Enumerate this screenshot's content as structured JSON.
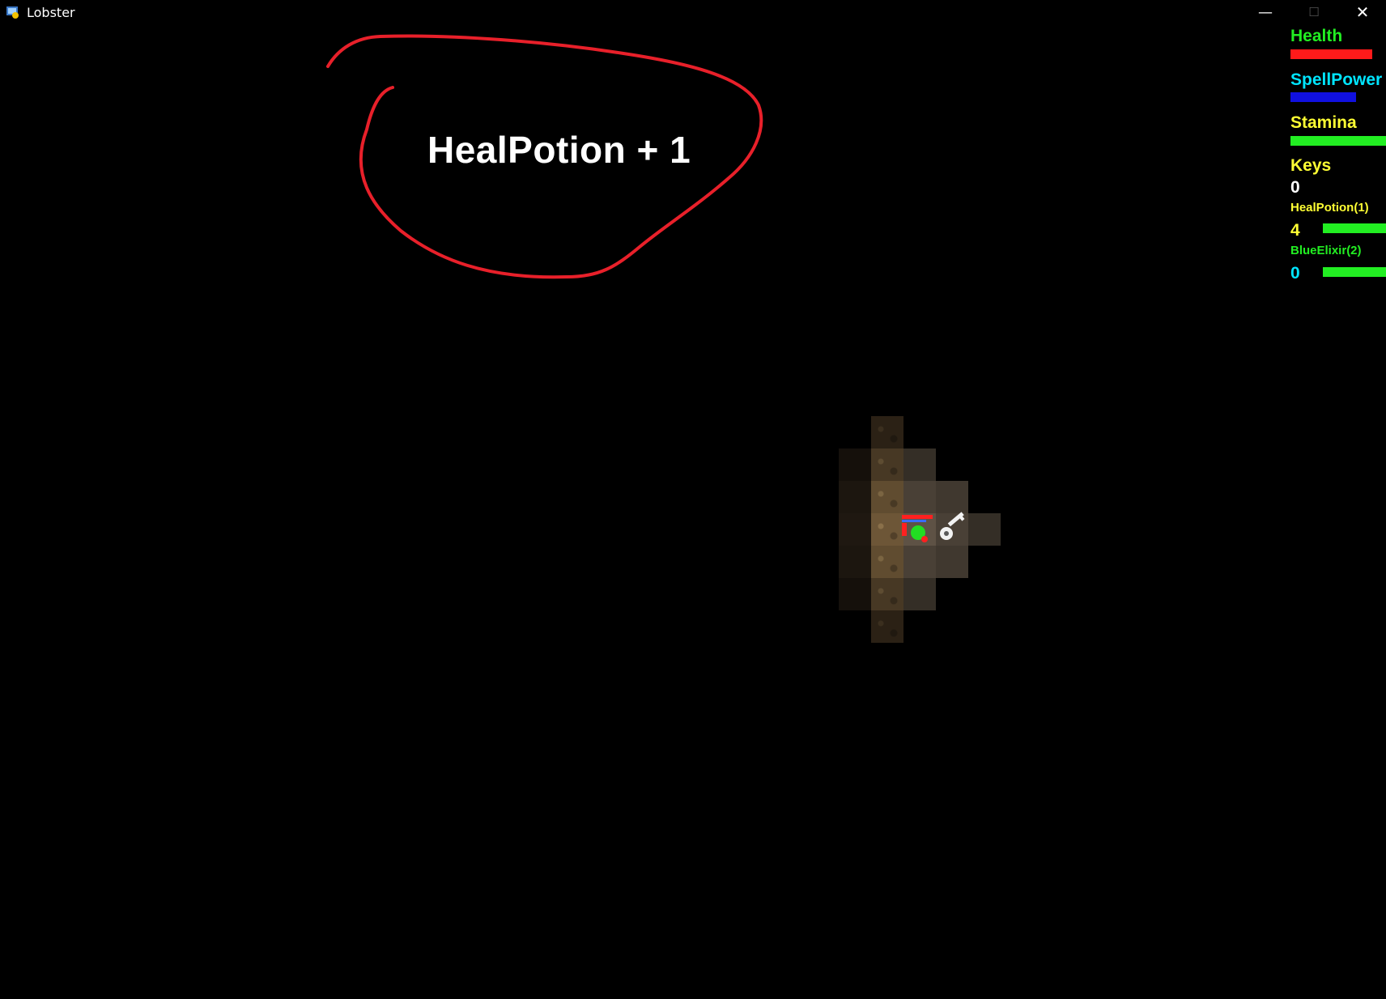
{
  "window": {
    "title": "Lobster",
    "minimize_glyph": "—",
    "maximize_glyph": "☐",
    "close_glyph": "✕"
  },
  "overlay": {
    "message": "HealPotion + 1",
    "annotation_color": "#e8202a"
  },
  "hud": {
    "health": {
      "label": "Health",
      "label_color": "#22ee22",
      "bar_color": "#ff1a1a",
      "level": 0.92
    },
    "spellpower": {
      "label": "SpellPower",
      "label_color": "#00e5ff",
      "bar_color": "#1010e0",
      "level": 0.69
    },
    "stamina": {
      "label": "Stamina",
      "label_color": "#ffff33",
      "bar_color": "#22ee22",
      "level": 1.0
    },
    "keys": {
      "label": "Keys",
      "label_color": "#ffff33",
      "value": "0",
      "value_color": "#ffffff"
    },
    "heal_potion": {
      "label": "HealPotion(1)",
      "label_color": "#ffff33",
      "count": "4",
      "count_color": "#ffff33",
      "bar_color": "#22ee22"
    },
    "blue_elixir": {
      "label": "BlueElixir(2)",
      "label_color": "#22ee22",
      "count": "0",
      "count_color": "#00e5ff",
      "bar_color": "#22ee22"
    }
  },
  "scene": {
    "player": {
      "icon": "player-icon",
      "body_color": "#22dd22"
    },
    "key_item": {
      "icon": "key-icon",
      "color": "#f2f2f2"
    }
  }
}
